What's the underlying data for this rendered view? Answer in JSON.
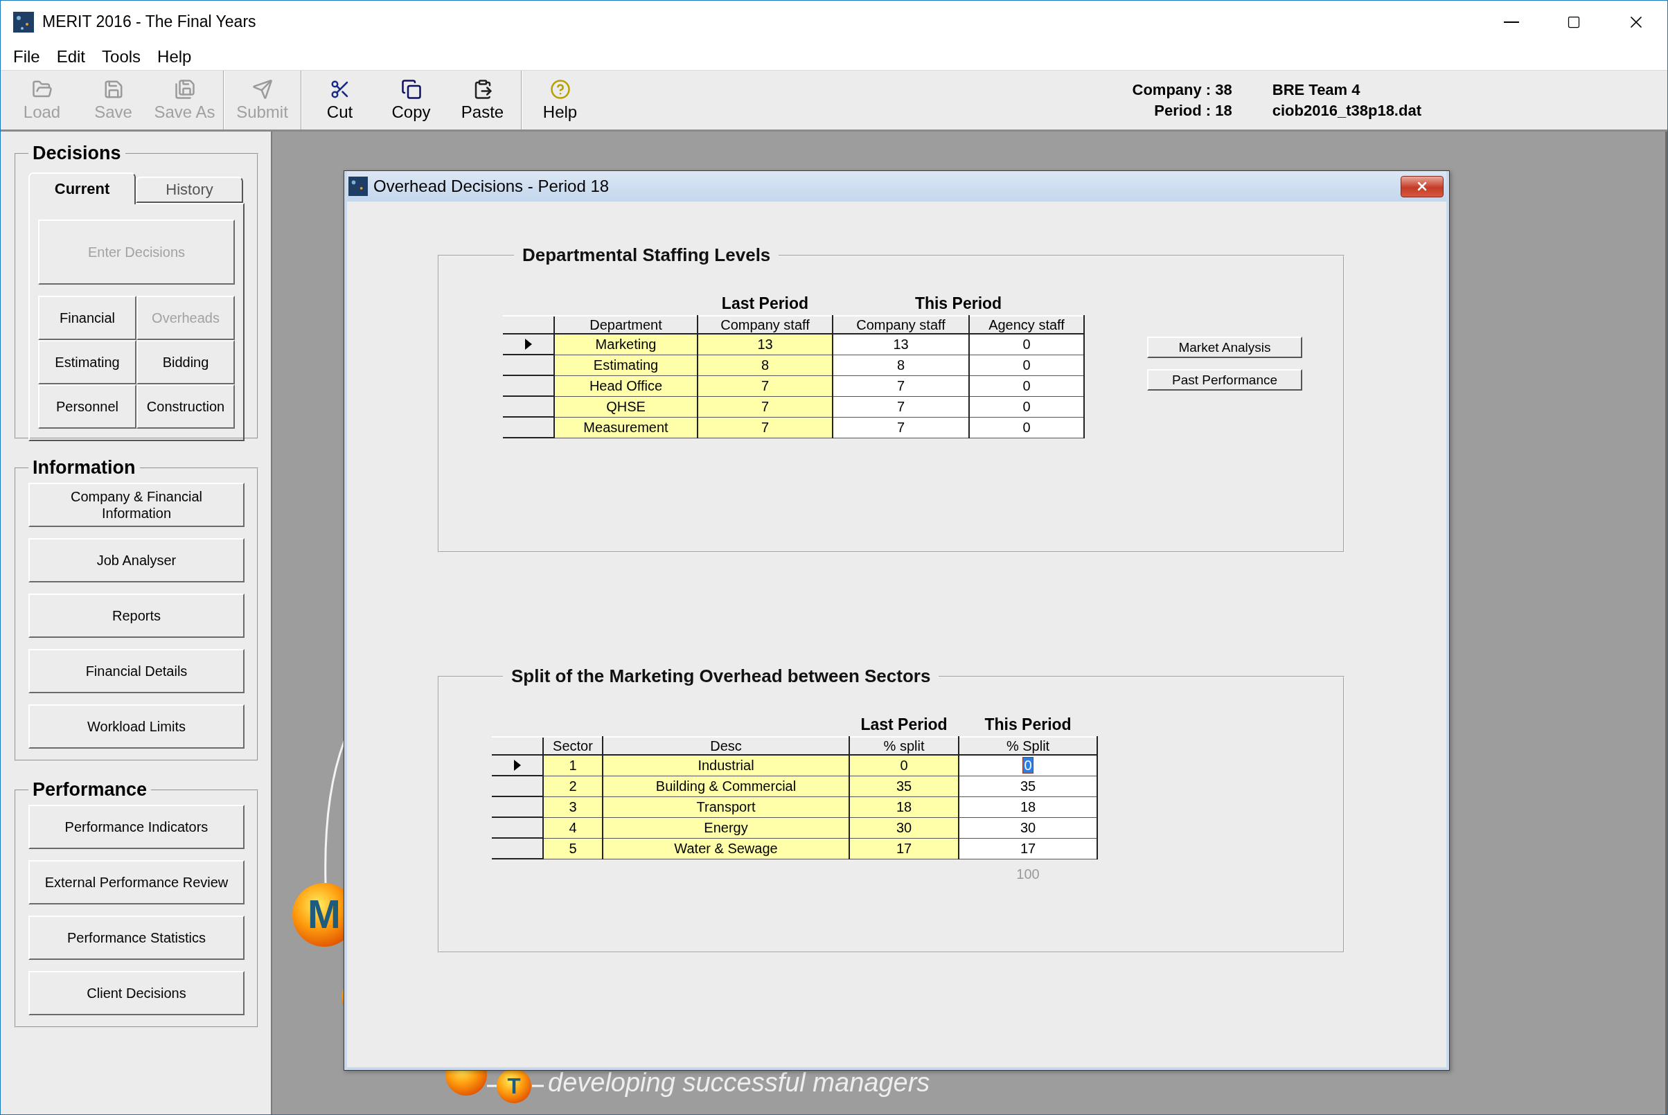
{
  "window": {
    "title": "MERIT 2016 - The Final Years"
  },
  "menu": [
    "File",
    "Edit",
    "Tools",
    "Help"
  ],
  "toolbar": {
    "groups": [
      [
        {
          "label": "Load",
          "disabled": true
        },
        {
          "label": "Save",
          "disabled": true
        },
        {
          "label": "Save As",
          "disabled": true
        }
      ],
      [
        {
          "label": "Submit",
          "disabled": true
        }
      ],
      [
        {
          "label": "Cut",
          "disabled": false
        },
        {
          "label": "Copy",
          "disabled": false
        },
        {
          "label": "Paste",
          "disabled": false
        }
      ],
      [
        {
          "label": "Help",
          "disabled": false
        }
      ]
    ],
    "info": [
      {
        "label": "Company : 38",
        "value": "BRE Team 4"
      },
      {
        "label": "Period : 18",
        "value": "ciob2016_t38p18.dat"
      }
    ]
  },
  "sidebar": {
    "decisions": {
      "title": "Decisions",
      "tabs": [
        {
          "label": "Current",
          "selected": true
        },
        {
          "label": "History",
          "selected": false
        }
      ],
      "main_button": {
        "label": "Enter Decisions",
        "disabled": true
      },
      "buttons": [
        {
          "label": "Financial",
          "disabled": false
        },
        {
          "label": "Overheads",
          "disabled": true
        },
        {
          "label": "Estimating",
          "disabled": false
        },
        {
          "label": "Bidding",
          "disabled": false
        },
        {
          "label": "Personnel",
          "disabled": false
        },
        {
          "label": "Construction",
          "disabled": false
        }
      ]
    },
    "information": {
      "title": "Information",
      "buttons": [
        {
          "label": "Company & Financial Information",
          "disabled": false
        },
        {
          "label": "Job Analyser",
          "disabled": false
        },
        {
          "label": "Reports",
          "disabled": false
        },
        {
          "label": "Financial Details",
          "disabled": false
        },
        {
          "label": "Workload Limits",
          "disabled": false
        }
      ]
    },
    "performance": {
      "title": "Performance",
      "buttons": [
        {
          "label": "Performance Indicators",
          "disabled": false
        },
        {
          "label": "External Performance Review",
          "disabled": false
        },
        {
          "label": "Performance Statistics",
          "disabled": false
        },
        {
          "label": "Client Decisions",
          "disabled": false
        }
      ]
    }
  },
  "logo": {
    "letters": [
      "M",
      "T"
    ],
    "tagline": "developing successful managers"
  },
  "dialog": {
    "title": "Overhead Decisions - Period 18",
    "sections": [
      {
        "title": "Departmental Staffing Levels",
        "lead_columns": [
          {
            "label": "Department",
            "editable": false
          }
        ],
        "column_groups": [
          {
            "label": "Last Period",
            "columns": [
              {
                "label": "Company staff",
                "editable": false
              }
            ]
          },
          {
            "label": "This Period",
            "columns": [
              {
                "label": "Company staff",
                "editable": true
              },
              {
                "label": "Agency staff",
                "editable": true
              }
            ]
          }
        ],
        "rows": [
          {
            "current": true,
            "editing": false,
            "cells": [
              "Marketing",
              "13",
              "13",
              "0"
            ]
          },
          {
            "current": false,
            "editing": false,
            "cells": [
              "Estimating",
              "8",
              "8",
              "0"
            ]
          },
          {
            "current": false,
            "editing": false,
            "cells": [
              "Head Office",
              "7",
              "7",
              "0"
            ]
          },
          {
            "current": false,
            "editing": false,
            "cells": [
              "QHSE",
              "7",
              "7",
              "0"
            ]
          },
          {
            "current": false,
            "editing": false,
            "cells": [
              "Measurement",
              "7",
              "7",
              "0"
            ]
          }
        ],
        "buttons": [
          "Market Analysis",
          "Past Performance"
        ]
      },
      {
        "title": "Split of the Marketing Overhead between Sectors",
        "lead_columns": [
          {
            "label": "Sector",
            "editable": false
          },
          {
            "label": "Desc",
            "editable": false
          }
        ],
        "column_groups": [
          {
            "label": "Last Period",
            "columns": [
              {
                "label": "% split",
                "editable": false
              }
            ]
          },
          {
            "label": "This Period",
            "columns": [
              {
                "label": "% Split",
                "editable": true
              }
            ]
          }
        ],
        "rows": [
          {
            "current": true,
            "editing": true,
            "cells": [
              "1",
              "Industrial",
              "0",
              "0"
            ]
          },
          {
            "current": false,
            "editing": false,
            "cells": [
              "2",
              "Building & Commercial",
              "35",
              "35"
            ]
          },
          {
            "current": false,
            "editing": false,
            "cells": [
              "3",
              "Transport",
              "18",
              "18"
            ]
          },
          {
            "current": false,
            "editing": false,
            "cells": [
              "4",
              "Energy",
              "30",
              "30"
            ]
          },
          {
            "current": false,
            "editing": false,
            "cells": [
              "5",
              "Water & Sewage",
              "17",
              "17"
            ]
          }
        ],
        "total": "100"
      }
    ]
  }
}
